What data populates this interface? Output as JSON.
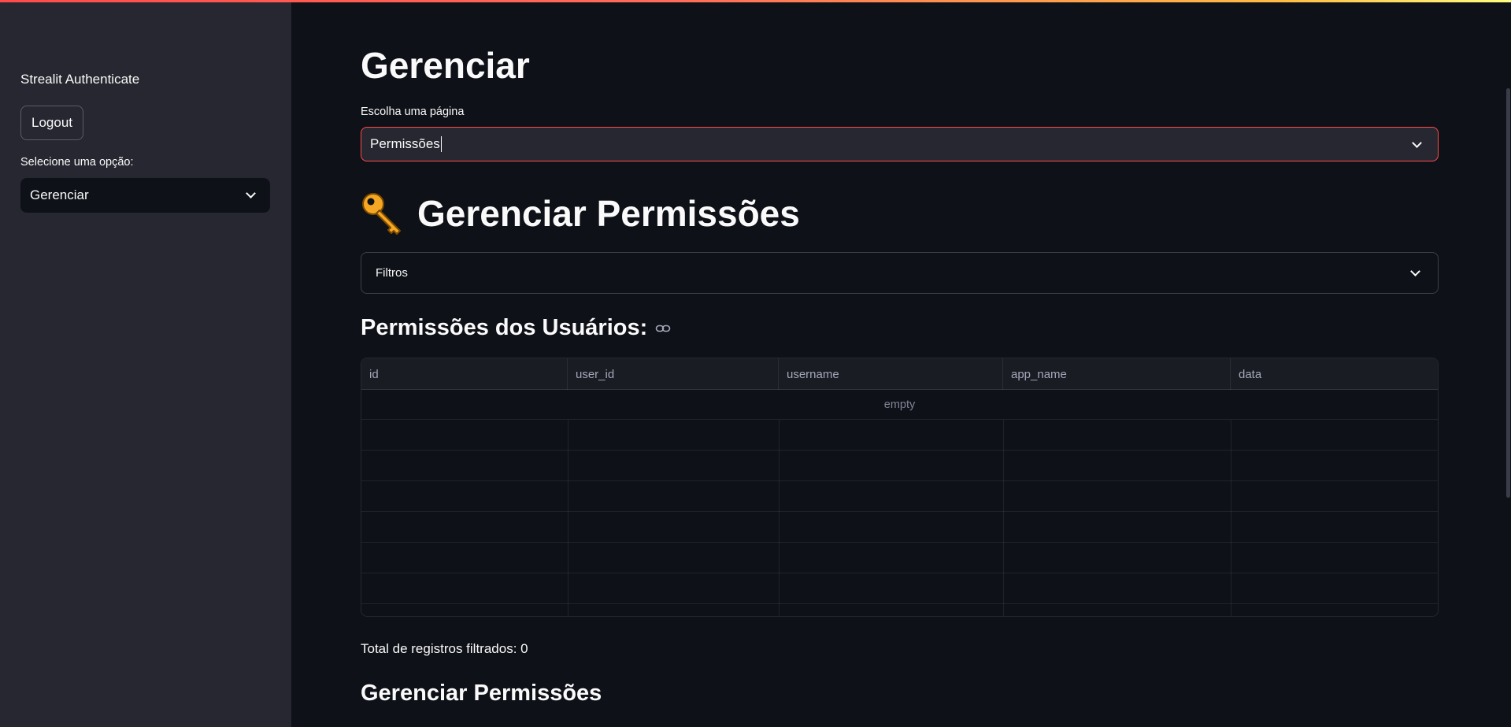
{
  "sidebar": {
    "title": "Strealit Authenticate",
    "logout_label": "Logout",
    "select_label": "Selecione uma opção:",
    "select_value": "Gerenciar"
  },
  "main": {
    "title": "Gerenciar",
    "page_select_label": "Escolha uma página",
    "page_select_value": "Permissões",
    "section_title": "Gerenciar Permissões",
    "filters_label": "Filtros",
    "table_title": "Permissões dos Usuários:",
    "table": {
      "columns": [
        "id",
        "user_id",
        "username",
        "app_name",
        "data"
      ],
      "empty_text": "empty"
    },
    "total_text": "Total de registros filtrados: 0",
    "bottom_title": "Gerenciar Permissões"
  },
  "icons": {
    "key": "key-icon",
    "link": "link-icon",
    "chevron": "chevron-down-icon"
  },
  "colors": {
    "background": "#0e1117",
    "sidebar": "#262730",
    "accent": "#ff4b4b",
    "key": "#f5a623"
  }
}
